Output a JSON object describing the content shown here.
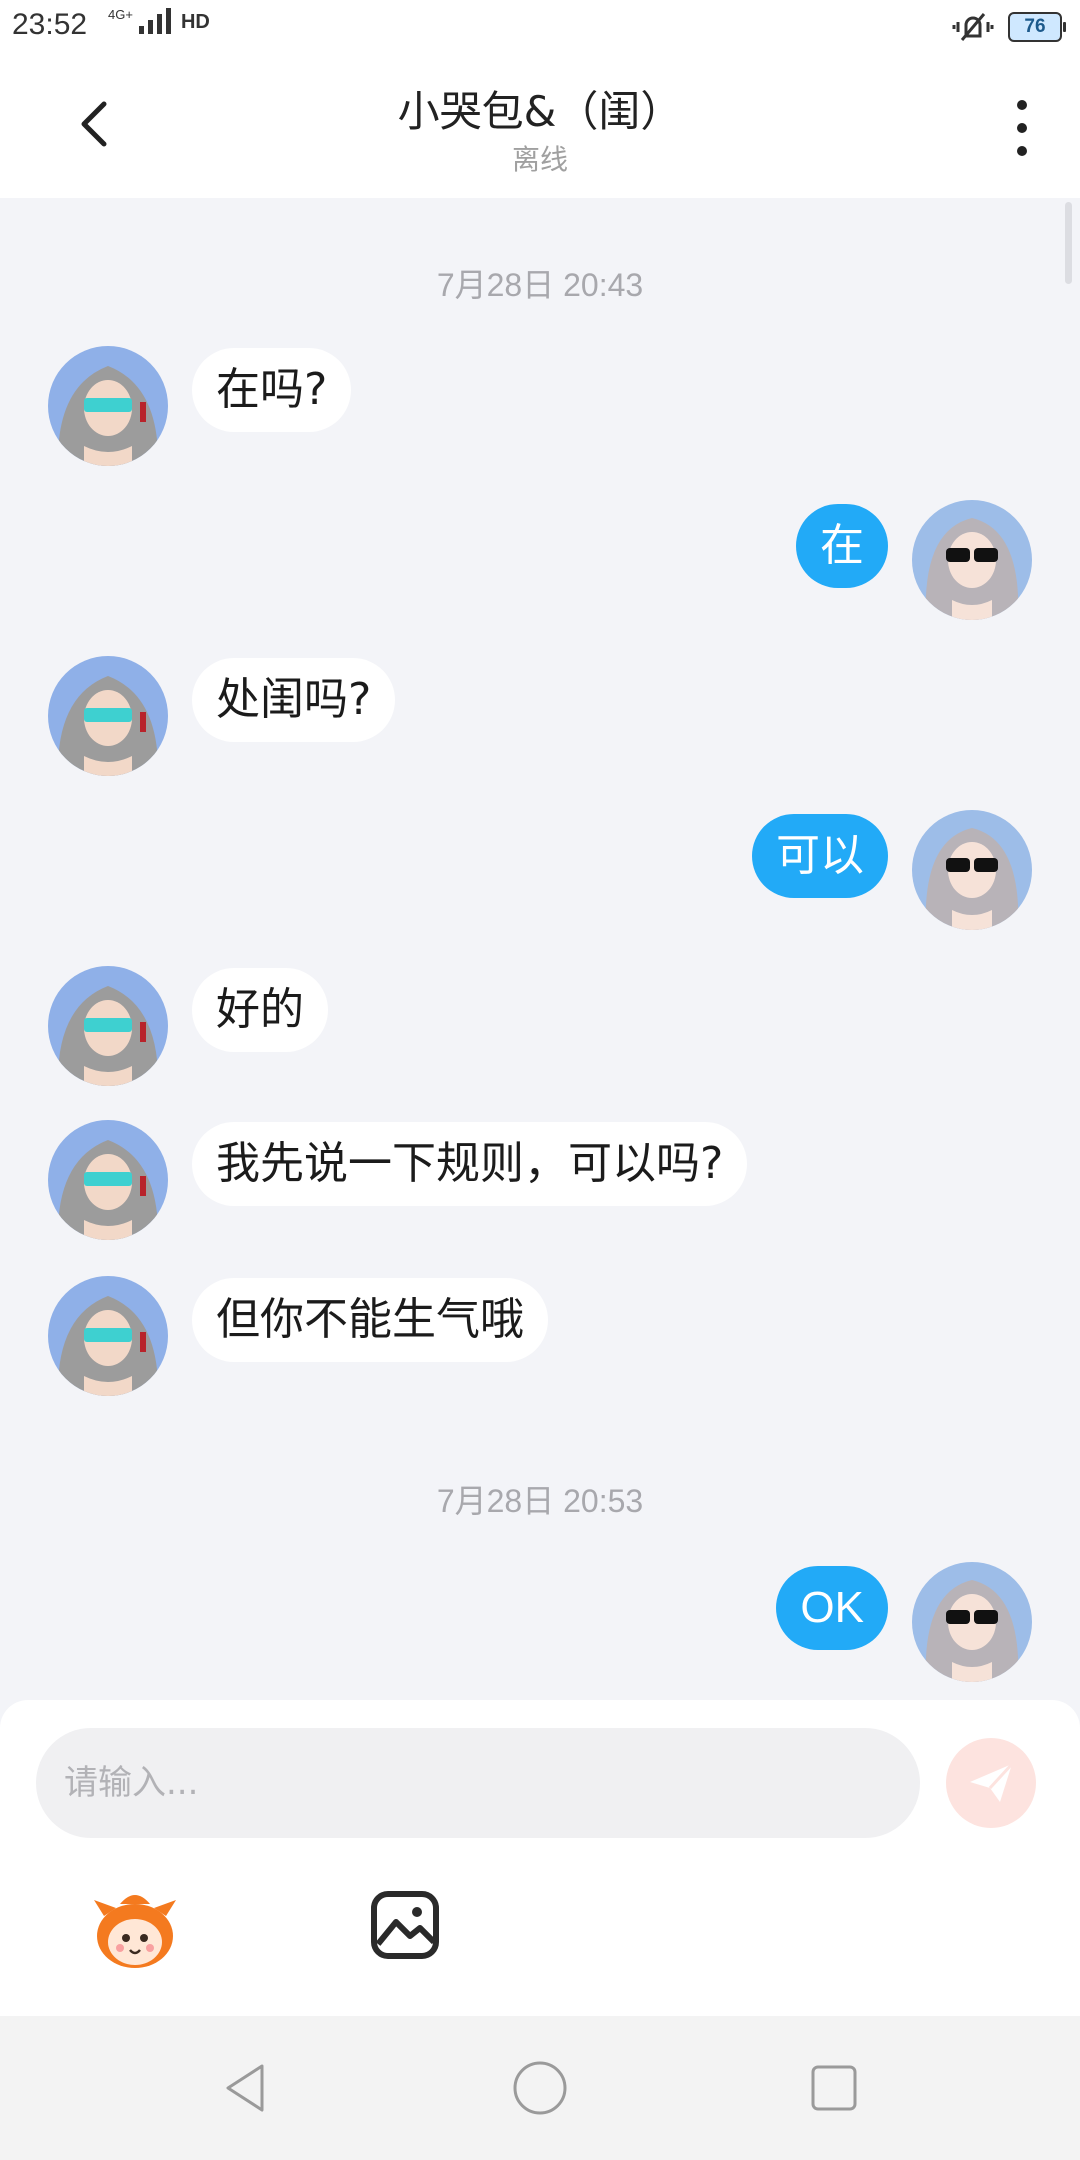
{
  "status_bar": {
    "time": "23:52",
    "network": "4G+",
    "hd": "HD",
    "battery": "76"
  },
  "header": {
    "title": "小哭包&（闺）",
    "subtitle": "离线"
  },
  "chat": {
    "timestamps": [
      "7月28日 20:43",
      "7月28日 20:53"
    ],
    "messages": [
      {
        "side": "in",
        "text": "在吗?"
      },
      {
        "side": "out",
        "text": "在"
      },
      {
        "side": "in",
        "text": "处闺吗?"
      },
      {
        "side": "out",
        "text": "可以"
      },
      {
        "side": "in",
        "text": "好的"
      },
      {
        "side": "in",
        "text": "我先说一下规则，可以吗?"
      },
      {
        "side": "in",
        "text": "但你不能生气哦"
      },
      {
        "side": "out",
        "text": "OK"
      }
    ]
  },
  "input": {
    "placeholder": "请输入..."
  },
  "toolbar": {
    "sticker_icon": "sticker-mascot-icon",
    "image_icon": "image-icon"
  },
  "colors": {
    "out_bubble": "#22aaf7",
    "in_bubble": "#ffffff",
    "background": "#f3f4f8",
    "send_button": "#fde3df"
  }
}
